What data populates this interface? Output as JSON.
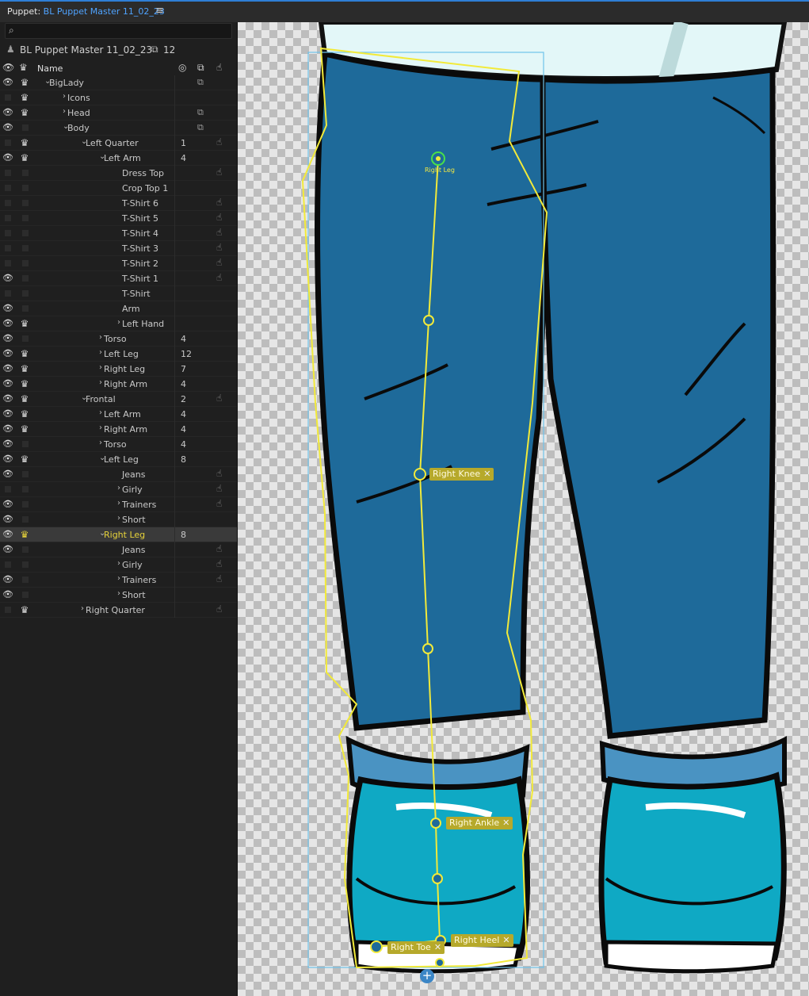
{
  "topbar": {
    "prefix": "Puppet:",
    "puppet_name": "BL Puppet Master 11_02_23",
    "menu_icon": "hamburger-icon"
  },
  "search": {
    "placeholder": ""
  },
  "puppet": {
    "name": "BL Puppet Master 11_02_23",
    "count": "12"
  },
  "columns": {
    "name": "Name"
  },
  "rows": [
    {
      "label": "BigLady",
      "indent": 0,
      "chev": "v",
      "eye": true,
      "crown": true,
      "num": "",
      "cam": true,
      "hand": false
    },
    {
      "label": "Icons",
      "indent": 1,
      "chev": ">",
      "eye": false,
      "crown": true,
      "num": "",
      "cam": false,
      "hand": false
    },
    {
      "label": "Head",
      "indent": 1,
      "chev": ">",
      "eye": true,
      "crown": true,
      "num": "",
      "cam": true,
      "hand": false
    },
    {
      "label": "Body",
      "indent": 1,
      "chev": "v",
      "eye": true,
      "crown": false,
      "num": "",
      "cam": true,
      "hand": false
    },
    {
      "label": "Left Quarter",
      "indent": 2,
      "chev": "v",
      "eye": false,
      "crown": true,
      "num": "1",
      "cam": false,
      "hand": true
    },
    {
      "label": "Left Arm",
      "indent": 3,
      "chev": "v",
      "eye": true,
      "crown": true,
      "num": "4",
      "cam": false,
      "hand": false
    },
    {
      "label": "Dress Top",
      "indent": 4,
      "chev": "",
      "eye": false,
      "crown": false,
      "num": "",
      "cam": false,
      "hand": true
    },
    {
      "label": "Crop Top 1",
      "indent": 4,
      "chev": "",
      "eye": false,
      "crown": false,
      "num": "",
      "cam": false,
      "hand": false
    },
    {
      "label": "T-Shirt 6",
      "indent": 4,
      "chev": "",
      "eye": false,
      "crown": false,
      "num": "",
      "cam": false,
      "hand": true
    },
    {
      "label": "T-Shirt 5",
      "indent": 4,
      "chev": "",
      "eye": false,
      "crown": false,
      "num": "",
      "cam": false,
      "hand": true
    },
    {
      "label": "T-Shirt 4",
      "indent": 4,
      "chev": "",
      "eye": false,
      "crown": false,
      "num": "",
      "cam": false,
      "hand": true
    },
    {
      "label": "T-Shirt 3",
      "indent": 4,
      "chev": "",
      "eye": false,
      "crown": false,
      "num": "",
      "cam": false,
      "hand": true
    },
    {
      "label": "T-Shirt 2",
      "indent": 4,
      "chev": "",
      "eye": false,
      "crown": false,
      "num": "",
      "cam": false,
      "hand": true
    },
    {
      "label": "T-Shirt 1",
      "indent": 4,
      "chev": "",
      "eye": true,
      "crown": false,
      "num": "",
      "cam": false,
      "hand": true
    },
    {
      "label": "T-Shirt",
      "indent": 4,
      "chev": "",
      "eye": false,
      "crown": false,
      "num": "",
      "cam": false,
      "hand": false
    },
    {
      "label": "Arm",
      "indent": 4,
      "chev": "",
      "eye": true,
      "crown": false,
      "num": "",
      "cam": false,
      "hand": false
    },
    {
      "label": "Left Hand",
      "indent": 4,
      "chev": ">",
      "eye": true,
      "crown": true,
      "num": "",
      "cam": false,
      "hand": false
    },
    {
      "label": "Torso",
      "indent": 3,
      "chev": ">",
      "eye": true,
      "crown": false,
      "num": "4",
      "cam": false,
      "hand": false
    },
    {
      "label": "Left Leg",
      "indent": 3,
      "chev": ">",
      "eye": true,
      "crown": true,
      "num": "12",
      "cam": false,
      "hand": false
    },
    {
      "label": "Right Leg",
      "indent": 3,
      "chev": ">",
      "eye": true,
      "crown": true,
      "num": "7",
      "cam": false,
      "hand": false
    },
    {
      "label": "Right Arm",
      "indent": 3,
      "chev": ">",
      "eye": true,
      "crown": true,
      "num": "4",
      "cam": false,
      "hand": false
    },
    {
      "label": "Frontal",
      "indent": 2,
      "chev": "v",
      "eye": true,
      "crown": true,
      "num": "2",
      "cam": false,
      "hand": true
    },
    {
      "label": "Left Arm",
      "indent": 3,
      "chev": ">",
      "eye": true,
      "crown": true,
      "num": "4",
      "cam": false,
      "hand": false
    },
    {
      "label": "Right Arm",
      "indent": 3,
      "chev": ">",
      "eye": true,
      "crown": true,
      "num": "4",
      "cam": false,
      "hand": false
    },
    {
      "label": "Torso",
      "indent": 3,
      "chev": ">",
      "eye": true,
      "crown": false,
      "num": "4",
      "cam": false,
      "hand": false
    },
    {
      "label": "Left Leg",
      "indent": 3,
      "chev": "v",
      "eye": true,
      "crown": true,
      "num": "8",
      "cam": false,
      "hand": false
    },
    {
      "label": "Jeans",
      "indent": 4,
      "chev": "",
      "eye": true,
      "crown": false,
      "num": "",
      "cam": false,
      "hand": true
    },
    {
      "label": "Girly",
      "indent": 4,
      "chev": ">",
      "eye": false,
      "crown": false,
      "num": "",
      "cam": false,
      "hand": true
    },
    {
      "label": "Trainers",
      "indent": 4,
      "chev": ">",
      "eye": true,
      "crown": false,
      "num": "",
      "cam": false,
      "hand": true
    },
    {
      "label": "Short",
      "indent": 4,
      "chev": ">",
      "eye": true,
      "crown": false,
      "num": "",
      "cam": false,
      "hand": false
    },
    {
      "label": "Right Leg",
      "indent": 3,
      "chev": "v",
      "eye": true,
      "crown": true,
      "num": "8",
      "cam": false,
      "hand": false,
      "selected": true
    },
    {
      "label": "Jeans",
      "indent": 4,
      "chev": "",
      "eye": true,
      "crown": false,
      "num": "",
      "cam": false,
      "hand": true
    },
    {
      "label": "Girly",
      "indent": 4,
      "chev": ">",
      "eye": false,
      "crown": false,
      "num": "",
      "cam": false,
      "hand": true
    },
    {
      "label": "Trainers",
      "indent": 4,
      "chev": ">",
      "eye": true,
      "crown": false,
      "num": "",
      "cam": false,
      "hand": true
    },
    {
      "label": "Short",
      "indent": 4,
      "chev": ">",
      "eye": true,
      "crown": false,
      "num": "",
      "cam": false,
      "hand": false
    },
    {
      "label": "Right Quarter",
      "indent": 2,
      "chev": ">",
      "eye": false,
      "crown": true,
      "num": "",
      "cam": false,
      "hand": true
    }
  ],
  "canvas": {
    "handles": {
      "right_leg": "Right Leg",
      "right_knee": "Right Knee",
      "right_ankle": "Right Ankle",
      "right_heel": "Right Heel",
      "right_toe": "Right Toe"
    },
    "colors": {
      "jeans": "#1e6a9a",
      "shoe": "#0fa9c4",
      "handle": "#f2ea3a",
      "bounds": "#6fc3ea"
    }
  }
}
